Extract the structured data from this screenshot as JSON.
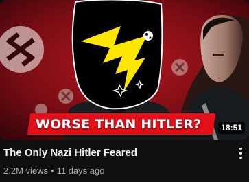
{
  "video": {
    "thumbnail_text": "WORSE THAN HITLER?",
    "duration": "18:51",
    "title": "The Only Nazi Hitler Feared",
    "views": "2.2M views",
    "separator": "•",
    "age": "11 days ago"
  },
  "icons": {
    "more": "more-vertical-icon",
    "bolt": "lightning-bolt-icon"
  },
  "colors": {
    "background": "#0f0f0f",
    "banner": "#e3101a",
    "bolt": "#ffe600",
    "thumb_red": "#8e1119"
  }
}
